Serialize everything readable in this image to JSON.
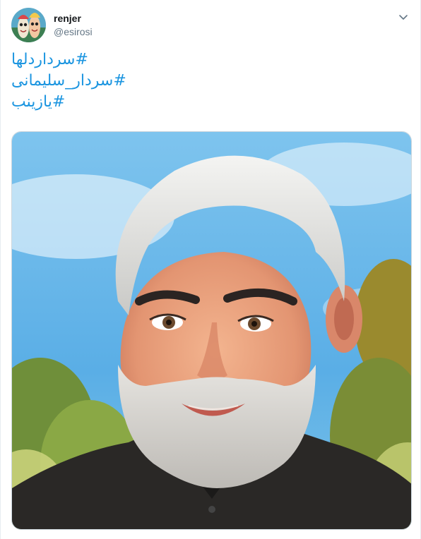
{
  "tweet": {
    "user": {
      "display_name": "renjer",
      "handle": "@esirosi",
      "avatar_icon": "avatar-cartoon-icon"
    },
    "menu_icon": "chevron-down-icon",
    "hashtags": [
      "#سرداردلها",
      "#سردار_سلیمانی",
      "#یازینب"
    ],
    "link_color": "#1b95e0",
    "media": {
      "type": "image",
      "subject_icon": "portrait-illustration-icon"
    }
  }
}
